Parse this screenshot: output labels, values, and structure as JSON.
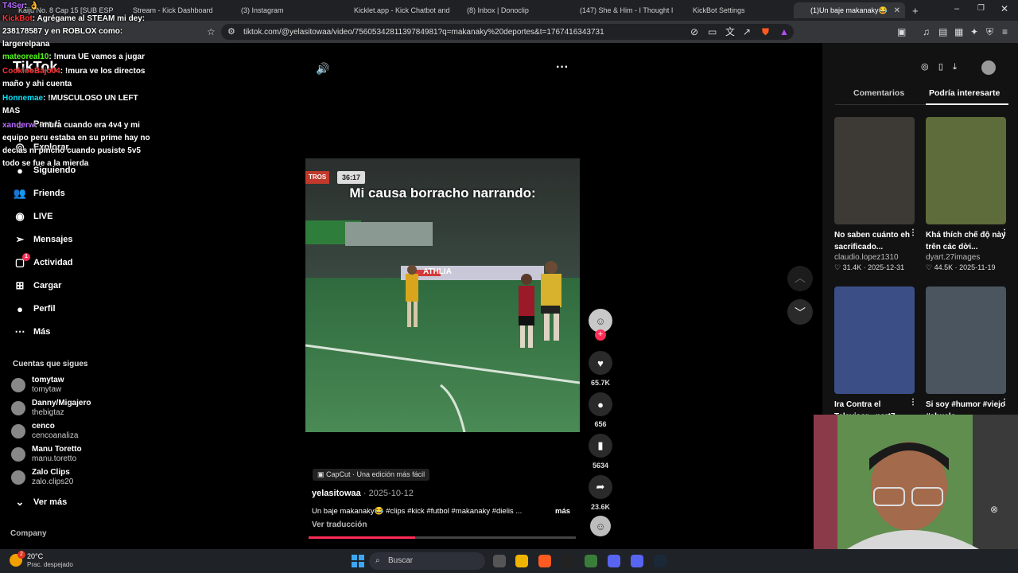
{
  "tabs": [
    {
      "label": "Kaiju No. 8 Cap 15 [SUB ESP",
      "color": "#e74c3c"
    },
    {
      "label": "Stream - Kick Dashboard",
      "color": "#53fc18"
    },
    {
      "label": "(3) Instagram",
      "color": "#d6249f"
    },
    {
      "label": "Kicklet.app - Kick Chatbot and",
      "color": "#7a7a7a"
    },
    {
      "label": "(8) Inbox | Donoclip",
      "color": "#f39c12"
    },
    {
      "label": "(147) She & Him - I Thought I",
      "color": "#ff0000"
    },
    {
      "label": "KickBot Settings",
      "color": "#53fc18"
    },
    {
      "label": "(1)Un baje makanaky😂",
      "color": "#ffffff"
    }
  ],
  "address": {
    "url": "tiktok.com/@yelasitowaa/video/7560534281139784981?q=makanaky%20deportes&t=1767416343731"
  },
  "chat": [
    {
      "user": "T4Ser",
      "user_color": "#b96bff",
      "text": ": 👌"
    },
    {
      "user": "KickBot",
      "user_color": "#ff3333",
      "text": ": Agrégame al STEAM mi dey: 238178587 y en ROBLOX como: largerelpana"
    },
    {
      "user": "mateoreal10",
      "user_color": "#53fc18",
      "text": ": !mura UE vamos a jugar"
    },
    {
      "user": "CookiooBajo04",
      "user_color": "#ff3333",
      "text": ": !mura ve los directos maño y ahi cuenta"
    },
    {
      "user": "Honnemae",
      "user_color": "#00e5ff",
      "text": ": !MUSCULOSO UN LEFT MAS"
    },
    {
      "user": "xanderw",
      "user_color": "#b96bff",
      "text": ": !mura cuando era 4v4 y mi equipo peru estaba en su prime hay no decias ni pincho cuando pusiste 5v5 todo se fue a la mierda"
    }
  ],
  "sidebar": {
    "logo": "TikTok",
    "nav": [
      {
        "label": "Para ti",
        "icon": "home-icon"
      },
      {
        "label": "Explorar",
        "icon": "compass-icon"
      },
      {
        "label": "Siguiendo",
        "icon": "following-icon"
      },
      {
        "label": "Friends",
        "icon": "friends-icon"
      },
      {
        "label": "LIVE",
        "icon": "live-icon"
      },
      {
        "label": "Mensajes",
        "icon": "send-icon"
      },
      {
        "label": "Actividad",
        "icon": "activity-icon",
        "badge": "1"
      },
      {
        "label": "Cargar",
        "icon": "upload-icon"
      },
      {
        "label": "Perfil",
        "icon": "profile-icon"
      },
      {
        "label": "Más",
        "icon": "more-icon"
      }
    ],
    "following_header": "Cuentas que sigues",
    "following": [
      {
        "name": "tomytaw",
        "handle": "tomytaw"
      },
      {
        "name": "Danny/Migajero",
        "handle": "thebigtaz"
      },
      {
        "name": "cenco",
        "handle": "cencoanaliza"
      },
      {
        "name": "Manu Toretto",
        "handle": "manu.toretto"
      },
      {
        "name": "Zalo Clips",
        "handle": "zalo.clips20"
      }
    ],
    "see_more": "Ver más",
    "company": "Company"
  },
  "video": {
    "caption_overlay": "Mi causa borracho narrando:",
    "time_badge": "36:17",
    "corner_tag": "TROS",
    "stadium_banner": "ATHLIA",
    "capcut": "CapCut · Una edición más fácil",
    "author": "yelasitowaa",
    "date": "2025-10-12",
    "description": "Un baje makanaky😂 #clips #kick #futbol #makanaky #dielis ...",
    "more": "más",
    "translate": "Ver traducción",
    "progress": 0.4
  },
  "actions": {
    "likes": "65.7K",
    "comments": "656",
    "saves": "5634",
    "shares": "23.6K"
  },
  "rpanel": {
    "tab_comments": "Comentarios",
    "tab_related": "Podría interesarte",
    "cards": [
      {
        "title": "No saben cuánto eh sacrificado...",
        "author": "claudio.lopez1310",
        "likes": "31.4K",
        "date": "2025-12-31",
        "bg": "#3d3a36"
      },
      {
        "title": "Khá thích chế độ này trên các dời...",
        "author": "dyart.27images",
        "likes": "44.5K",
        "date": "2025-11-19",
        "bg": "#5e6b3a"
      },
      {
        "title": "Ira Contra el Televisor - part7",
        "author": "",
        "likes": "",
        "date": "",
        "bg": "#3b4f86"
      },
      {
        "title": "Si soy #humor #viejo #abuelo",
        "author": "",
        "likes": "",
        "date": "",
        "bg": "#4a5560"
      }
    ]
  },
  "taskbar": {
    "weather_temp": "20°C",
    "weather_desc": "Prac. despejado",
    "weather_badge": "2",
    "search": "Buscar",
    "apps": [
      "#f0b400",
      "#ff5a1f",
      "#222",
      "#3a7d3a",
      "#5865f2",
      "#5865f2",
      "#1b2838"
    ]
  }
}
